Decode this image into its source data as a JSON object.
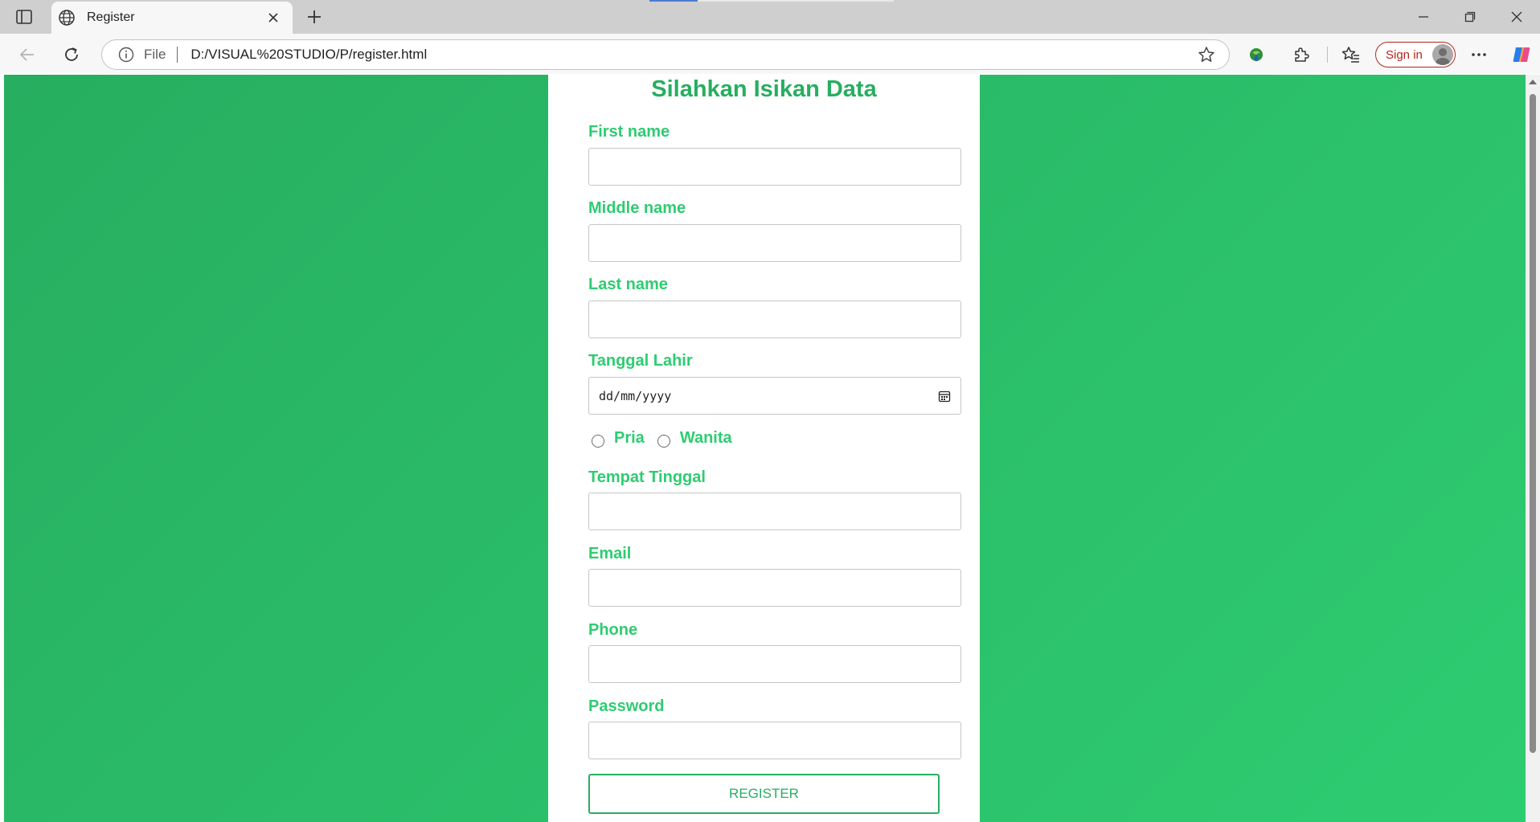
{
  "browser": {
    "tab_title": "Register",
    "address": {
      "scheme_label": "File",
      "url": "D:/VISUAL%20STUDIO/P/register.html"
    },
    "signin_label": "Sign in"
  },
  "form": {
    "title": "Silahkan Isikan Data",
    "fields": {
      "first_name": {
        "label": "First name",
        "value": ""
      },
      "middle_name": {
        "label": "Middle name",
        "value": ""
      },
      "last_name": {
        "label": "Last name",
        "value": ""
      },
      "birth_date": {
        "label": "Tanggal Lahir",
        "placeholder": "dd/mm/yyyy"
      },
      "gender": {
        "options": [
          "Pria",
          "Wanita"
        ],
        "selected": null
      },
      "address": {
        "label": "Tempat Tinggal",
        "value": ""
      },
      "email": {
        "label": "Email",
        "value": ""
      },
      "phone": {
        "label": "Phone",
        "value": ""
      },
      "password": {
        "label": "Password",
        "value": ""
      }
    },
    "submit_label": "REGISTER"
  },
  "colors": {
    "accent": "#27ae60",
    "accent_light": "#2ecc71",
    "signin": "#b3261e"
  }
}
